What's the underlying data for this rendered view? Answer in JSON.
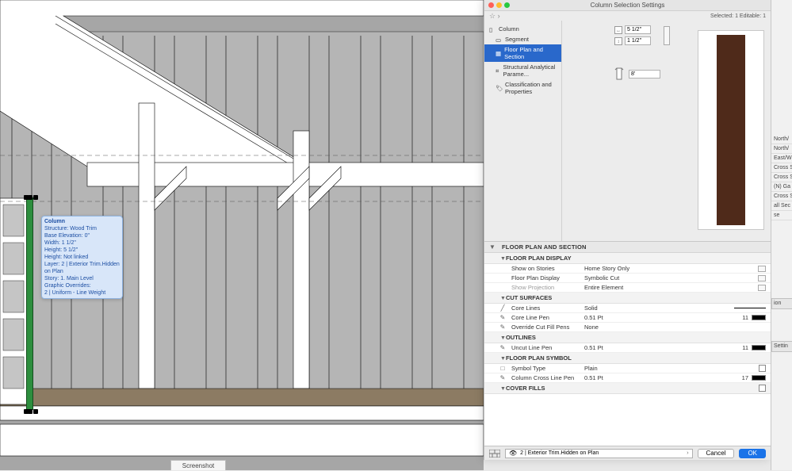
{
  "dialog": {
    "title": "Column Selection Settings",
    "selected_label": "Selected: 1 Editable: 1",
    "nav": [
      {
        "label": "Column",
        "icon": "column-icon"
      },
      {
        "label": "Segment",
        "icon": "segment-icon"
      },
      {
        "label": "Floor Plan and Section",
        "icon": "plan-icon",
        "selected": true
      },
      {
        "label": "Structural Analytical Parame...",
        "icon": "struct-icon"
      },
      {
        "label": "Classification and Properties",
        "icon": "class-icon"
      }
    ],
    "geom": {
      "width": "5 1/2\"",
      "depth": "1 1/2\"",
      "height": "8'"
    },
    "section_title": "FLOOR PLAN AND SECTION",
    "groups": [
      {
        "title": "FLOOR PLAN DISPLAY",
        "rows": [
          {
            "label": "Show on Stories",
            "value": "Home Story Only",
            "tail": "ico"
          },
          {
            "label": "Floor Plan Display",
            "value": "Symbolic Cut",
            "tail": "ico"
          },
          {
            "label": "Show Projection",
            "value": "Entire Element",
            "dim": true,
            "tail": "ico"
          }
        ]
      },
      {
        "title": "CUT SURFACES",
        "rows": [
          {
            "pic": "╱",
            "label": "Core Lines",
            "value": "Solid",
            "tail": "line"
          },
          {
            "pic": "✎",
            "label": "Core Line Pen",
            "value": "0.51 Pt",
            "num": "11",
            "tail": "pen"
          },
          {
            "pic": "✎",
            "label": "Override Cut Fill Pens",
            "value": "None"
          }
        ]
      },
      {
        "title": "OUTLINES",
        "rows": [
          {
            "pic": "✎",
            "label": "Uncut Line Pen",
            "value": "0.51 Pt",
            "num": "11",
            "tail": "pen"
          }
        ]
      },
      {
        "title": "FLOOR PLAN SYMBOL",
        "rows": [
          {
            "pic": "□",
            "label": "Symbol Type",
            "value": "Plain",
            "tail": "chk"
          },
          {
            "pic": "✎",
            "label": "Column Cross Line Pen",
            "value": "0.51 Pt",
            "num": "17",
            "tail": "pen"
          }
        ]
      },
      {
        "title": "COVER FILLS",
        "rows": [
          {
            "label": "",
            "value": "",
            "tail": "chk"
          }
        ],
        "inline_chk": true
      }
    ],
    "layer": "2 | Exterior Trim.Hidden on Plan",
    "cancel": "Cancel",
    "ok": "OK"
  },
  "tooltip": {
    "title": "Column",
    "lines": [
      "Structure: Wood Trim",
      "Base Elevation: 0\"",
      "Width: 1 1/2\"",
      "Height: 5 1/2\"",
      "Height: Not linked",
      "Layer: 2 | Exterior Trim.Hidden on Plan",
      "Story: 1. Main Level",
      "Graphic Overrides:",
      "2 | Uniform - Line Weight"
    ]
  },
  "bottom_tab": "Screenshot",
  "peek_rows": [
    "North/",
    "North/",
    "East/W",
    "Cross S",
    "Cross S",
    "(N) Ga",
    "Cross S",
    "",
    "all Sec",
    "se",
    "",
    "on"
  ],
  "peek_tab2": "ion",
  "peek_tab": "Settin"
}
